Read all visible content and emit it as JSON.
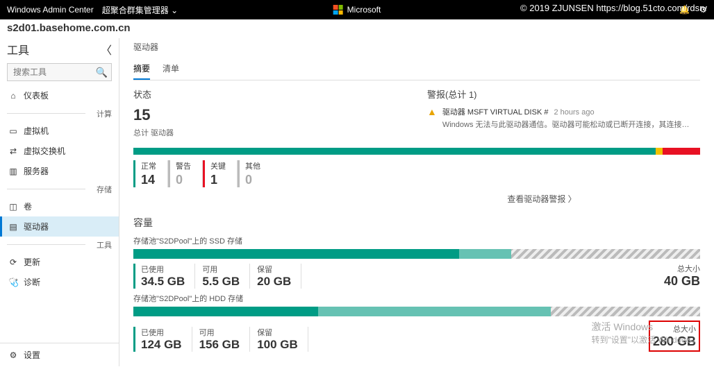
{
  "topbar": {
    "app": "Windows Admin Center",
    "context": "超聚合群集管理器",
    "brand": "Microsoft"
  },
  "watermark": "© 2019 ZJUNSEN https://blog.51cto.com/rdsrv",
  "cluster": "s2d01.basehome.com.cn",
  "sidebar": {
    "tools": "工具",
    "search_ph": "搜索工具",
    "groups": {
      "compute": "计算",
      "storage": "存储",
      "tools": "工具"
    },
    "items": {
      "dashboard": "仪表板",
      "vm": "虚拟机",
      "vswitch": "虚拟交换机",
      "servers": "服务器",
      "volumes": "卷",
      "drives": "驱动器",
      "updates": "更新",
      "diagnostics": "诊断",
      "settings": "设置"
    }
  },
  "main": {
    "breadcrumb": "驱动器",
    "tabs": {
      "summary": "摘要",
      "inventory": "清单"
    },
    "status": {
      "title": "状态",
      "count": "15",
      "sub": "总计 驱动器"
    },
    "alerts": {
      "title": "警报(总计 1)",
      "item": {
        "name": "驱动器 MSFT VIRTUAL DISK #",
        "time": "2 hours ago",
        "msg": "Windows 无法与此驱动器通信。驱动器可能松动或已断开连接，其连接器可能发生了故障，或驱动器本身可能..."
      }
    },
    "bars": {
      "normal": {
        "lbl": "正常",
        "val": "14"
      },
      "warn": {
        "lbl": "警告",
        "val": "0"
      },
      "crit": {
        "lbl": "关键",
        "val": "1"
      },
      "other": {
        "lbl": "其他",
        "val": "0"
      }
    },
    "viewalerts": "查看驱动器警报",
    "capacity": {
      "title": "容量",
      "used": "已使用",
      "free": "可用",
      "reserved": "保留",
      "total": "总大小",
      "ssd": {
        "lbl": "存储池\"S2DPool\"上的 SSD 存储",
        "used": "34.5 GB",
        "free": "5.5 GB",
        "res": "20 GB",
        "total": "40 GB"
      },
      "hdd": {
        "lbl": "存储池\"S2DPool\"上的 HDD 存储",
        "used": "124 GB",
        "free": "156 GB",
        "res": "100 GB",
        "total": "280 GB"
      }
    }
  },
  "activate": {
    "l1": "激活 Windows",
    "l2": "转到\"设置\"以激活 Windows。"
  }
}
